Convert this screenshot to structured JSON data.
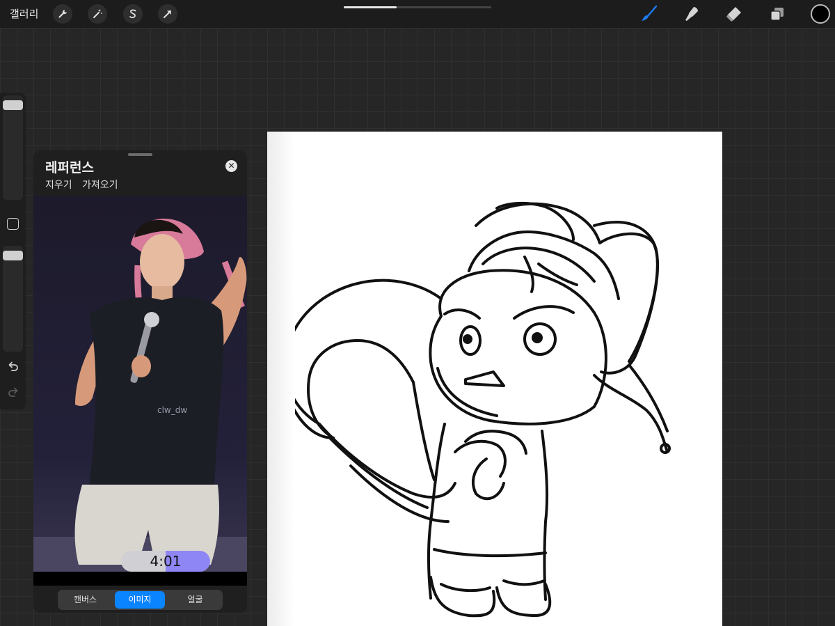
{
  "topbar": {
    "gallery_label": "갤러리",
    "tools_left": [
      "wrench-icon",
      "magic-wand-icon",
      "selection-icon",
      "transform-arrow-icon"
    ],
    "progress_fraction": 0.36,
    "tools_right": [
      "brush-icon",
      "smudge-icon",
      "eraser-icon",
      "layers-icon"
    ],
    "accent_color": "#1e7cf5",
    "current_color": "#000000"
  },
  "sidebar": {
    "brush_size_level": 0.05,
    "opacity_level": 0.05
  },
  "reference": {
    "title": "레퍼런스",
    "actions": [
      "지우기",
      "가져오기"
    ],
    "watermark": "clw_dw",
    "video_time": "4:01",
    "tabs": [
      {
        "label": "캔버스",
        "active": false
      },
      {
        "label": "이미지",
        "active": true
      },
      {
        "label": "얼굴",
        "active": false
      }
    ]
  }
}
